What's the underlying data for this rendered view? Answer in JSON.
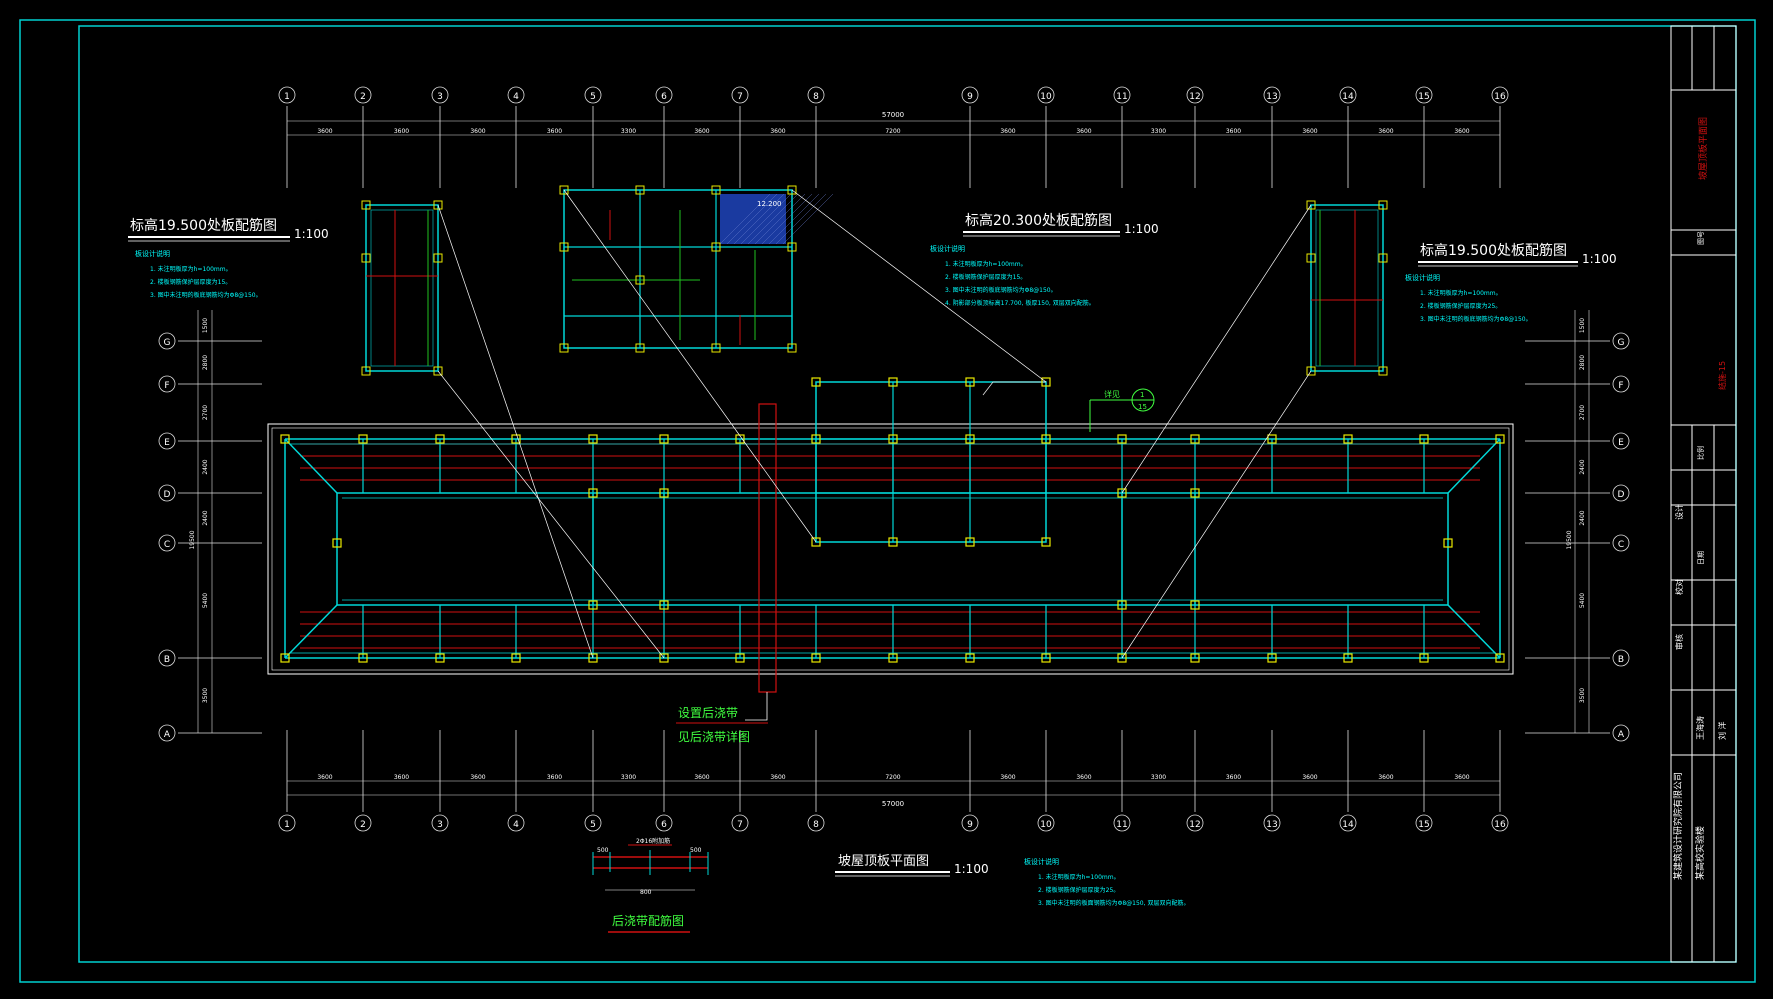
{
  "title_left": {
    "text": "标高19.500处板配筋图",
    "scale": "1:100"
  },
  "title_center": {
    "text": "标高20.300处板配筋图",
    "scale": "1:100"
  },
  "title_right": {
    "text": "标高19.500处板配筋图",
    "scale": "1:100"
  },
  "title_main": {
    "text": "坡屋顶板平面图",
    "scale": "1:100"
  },
  "title_detail": {
    "text": "后浇带配筋图"
  },
  "notes_heading": "板设计说明",
  "notes_left": [
    "1. 未注明板厚为h=100mm。",
    "2. 楼板钢筋保护层厚度为15。",
    "3. 图中未注明的板底钢筋均为Φ8@150。"
  ],
  "notes_center": [
    "1. 未注明板厚为h=100mm。",
    "2. 楼板钢筋保护层厚度为15。",
    "3. 图中未注明的板底钢筋均为Φ8@150。",
    "4. 阴影部分板顶标高17.700, 板厚150, 双层双向配筋。"
  ],
  "notes_right": [
    "1. 未注明板厚为h=100mm。",
    "2. 楼板钢筋保护层厚度为25。",
    "3. 图中未注明的板底钢筋均为Φ8@150。"
  ],
  "notes_bottom": [
    "1. 未注明板厚为h=100mm。",
    "2. 楼板钢筋保护层厚度为25。",
    "3. 图中未注明的板面钢筋均为Φ8@150, 双层双向配筋。"
  ],
  "elevation_tag": "12.200",
  "section_ref": {
    "label": "详见",
    "top": "1",
    "bottom": "15"
  },
  "post_pour": {
    "line1": "设置后浇带",
    "line2": "见后浇带详图"
  },
  "detail_dims": [
    "500",
    "500",
    "800"
  ],
  "detail_label": "2Φ16附加筋",
  "grid_cols": [
    "1",
    "2",
    "3",
    "4",
    "5",
    "6",
    "7",
    "8",
    "9",
    "10",
    "11",
    "12",
    "13",
    "14",
    "15",
    "16"
  ],
  "spacings": [
    "3600",
    "3600",
    "3600",
    "3600",
    "3300",
    "3600",
    "3600",
    "7200",
    "3600",
    "3600",
    "3300",
    "3600",
    "3600",
    "3600",
    "3600"
  ],
  "total_dim": "57000",
  "grid_rows": [
    "G",
    "F",
    "E",
    "D",
    "C",
    "B",
    "A"
  ],
  "row_spacings": [
    "1500",
    "2800",
    "2700",
    "2400",
    "2400",
    "5400",
    "3500"
  ],
  "row_total": "19500",
  "title_block": {
    "company": "某建筑设计研究院有限公司",
    "project": "某高校实验楼",
    "drawing_name": "坡屋顶板平面图",
    "design": "设计",
    "check": "校对",
    "approve": "审核",
    "scale_label": "比例",
    "date_label": "日期",
    "sheet_label": "图号",
    "sheet_no": "结施-15",
    "name_a": "王海涛",
    "name_b": "刘 洋"
  },
  "colors": {
    "frame": "#00e5e5",
    "beam": "#00d8d8",
    "column": "#e8e800",
    "rebar_red": "#d01010",
    "rebar_green": "#20c020",
    "dim": "#e0e0e0",
    "text_white": "#ffffff",
    "text_cyan": "#00ffff",
    "text_green": "#40ff40",
    "fill_blue": "#1a3aa0"
  }
}
